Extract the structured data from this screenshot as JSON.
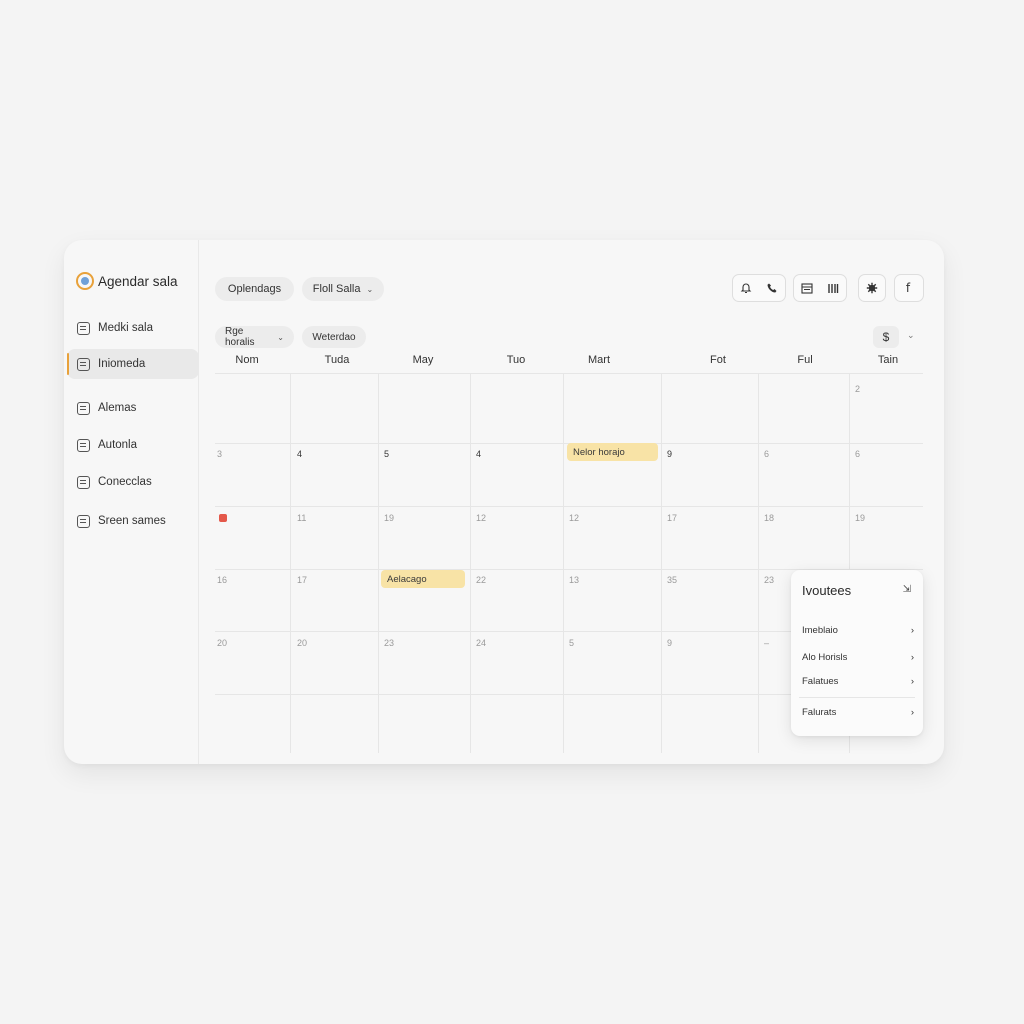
{
  "app": {
    "brand": "Agendar sala"
  },
  "sidebar": {
    "items": [
      {
        "label": "Medki sala",
        "icon": "calendar-icon"
      },
      {
        "label": "Iniomeda",
        "icon": "document-icon",
        "active": true
      },
      {
        "label": "Alemas",
        "icon": "list-icon"
      },
      {
        "label": "Autonla",
        "icon": "checklist-icon"
      },
      {
        "label": "Conecclas",
        "icon": "link-icon"
      },
      {
        "label": "Sreen sames",
        "icon": "screen-icon"
      }
    ]
  },
  "toolbar": {
    "pill1": "Oplendags",
    "pill2": "Floll Salla",
    "filter1": "Rge horalis",
    "filter2": "Weterdao",
    "currency": "$",
    "icons": [
      "bell-icon",
      "phone-icon",
      "calendar-view-icon",
      "columns-view-icon",
      "settings-icon",
      "facebook-icon"
    ]
  },
  "calendar": {
    "days": [
      "Nom",
      "Tuda",
      "May",
      "Tuo",
      "Mart",
      "Fot",
      "Ful",
      "Tain"
    ],
    "rows": [
      [
        "",
        "",
        "",
        "",
        "",
        "",
        "",
        "2"
      ],
      [
        "3",
        "4",
        "5",
        "4",
        "",
        "9",
        "6",
        "6"
      ],
      [
        "",
        "11",
        "19",
        "12",
        "12",
        "17",
        "18",
        "19"
      ],
      [
        "16",
        "17",
        "",
        "22",
        "13",
        "35",
        "23",
        ""
      ],
      [
        "20",
        "20",
        "23",
        "24",
        "5",
        "9",
        "–",
        ""
      ]
    ],
    "events": {
      "e1": "Nelor horajo",
      "e2": "Aelacago"
    }
  },
  "popover": {
    "title": "Ivoutees",
    "items": [
      "Imeblaio",
      "Alo Horisls",
      "Falatues",
      "Falurats"
    ]
  },
  "colors": {
    "accent": "#e8a13a",
    "event": "#f8e3a6",
    "alert": "#e4584a"
  }
}
